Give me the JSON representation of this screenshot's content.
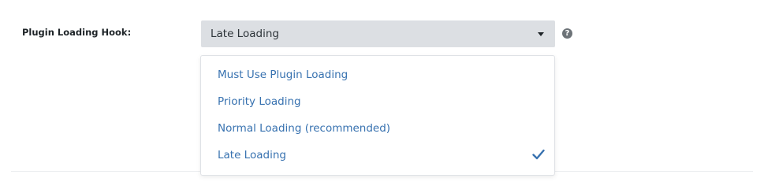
{
  "setting": {
    "label": "Plugin Loading Hook:",
    "selected_value": "Late Loading",
    "help_icon_glyph": "?"
  },
  "dropdown": {
    "options": [
      {
        "label": "Must Use Plugin Loading",
        "selected": false
      },
      {
        "label": "Priority Loading",
        "selected": false
      },
      {
        "label": "Normal Loading (recommended)",
        "selected": false
      },
      {
        "label": "Late Loading",
        "selected": true
      }
    ]
  },
  "icons": {
    "caret": "chevron-down-icon",
    "help": "help-icon",
    "check": "check-icon"
  },
  "colors": {
    "select_background": "#dcdfe3",
    "option_text": "#3872b0",
    "check_color": "#3872b0"
  }
}
